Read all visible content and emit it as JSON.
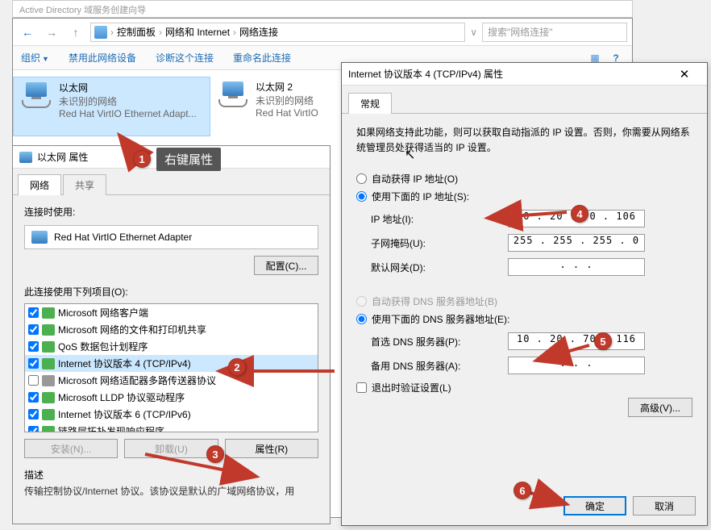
{
  "bg_window_title": "Active Directory 域服务创建向导",
  "nc": {
    "window_title": "网络连接",
    "breadcrumb": [
      "控制面板",
      "网络和 Internet",
      "网络连接"
    ],
    "search_placeholder": "搜索\"网络连接\"",
    "toolbar": {
      "organize": "组织",
      "disable": "禁用此网络设备",
      "diagnose": "诊断这个连接",
      "rename": "重命名此连接"
    },
    "items": [
      {
        "name": "以太网",
        "status": "未识别的网络",
        "adapter": "Red Hat VirtIO Ethernet Adapt..."
      },
      {
        "name": "以太网 2",
        "status": "未识别的网络",
        "adapter": "Red Hat VirtIO"
      }
    ]
  },
  "eth": {
    "title": "以太网 属性",
    "tabs": [
      "网络",
      "共享"
    ],
    "connect_label": "连接时使用:",
    "adapter": "Red Hat VirtIO Ethernet Adapter",
    "config_btn": "配置(C)...",
    "list_label": "此连接使用下列项目(O):",
    "items": [
      {
        "checked": true,
        "label": "Microsoft 网络客户端"
      },
      {
        "checked": true,
        "label": "Microsoft 网络的文件和打印机共享"
      },
      {
        "checked": true,
        "label": "QoS 数据包计划程序"
      },
      {
        "checked": true,
        "label": "Internet 协议版本 4 (TCP/IPv4)",
        "selected": true
      },
      {
        "checked": false,
        "label": "Microsoft 网络适配器多路传送器协议"
      },
      {
        "checked": true,
        "label": "Microsoft LLDP 协议驱动程序"
      },
      {
        "checked": true,
        "label": "Internet 协议版本 6 (TCP/IPv6)"
      },
      {
        "checked": true,
        "label": "链路层拓扑发现响应程序"
      }
    ],
    "btns": {
      "install": "安装(N)...",
      "uninstall": "卸载(U)",
      "props": "属性(R)"
    },
    "desc_title": "描述",
    "desc_text": "传输控制协议/Internet 协议。该协议是默认的广域网络协议，用"
  },
  "ip": {
    "title": "Internet 协议版本 4 (TCP/IPv4) 属性",
    "tab": "常规",
    "intro": "如果网络支持此功能，则可以获取自动指派的 IP 设置。否则，你需要从网络系统管理员处获得适当的 IP 设置。",
    "radio_auto_ip": "自动获得 IP 地址(O)",
    "radio_use_ip": "使用下面的 IP 地址(S):",
    "ip_label": "IP 地址(I):",
    "ip_value": "10 . 20 . 70 . 106",
    "mask_label": "子网掩码(U):",
    "mask_value": "255 . 255 . 255 .  0",
    "gw_label": "默认网关(D):",
    "gw_value": ".       .       .",
    "radio_auto_dns": "自动获得 DNS 服务器地址(B)",
    "radio_use_dns": "使用下面的 DNS 服务器地址(E):",
    "dns1_label": "首选 DNS 服务器(P):",
    "dns1_value": "10 . 20 . 70 . 116",
    "dns2_label": "备用 DNS 服务器(A):",
    "dns2_value": ".       .       .",
    "chk_validate": "退出时验证设置(L)",
    "adv_btn": "高级(V)...",
    "ok_btn": "确定",
    "cancel_btn": "取消"
  },
  "ann": {
    "tooltip": "右键属性",
    "badges": [
      "1",
      "2",
      "3",
      "4",
      "5",
      "6"
    ]
  }
}
